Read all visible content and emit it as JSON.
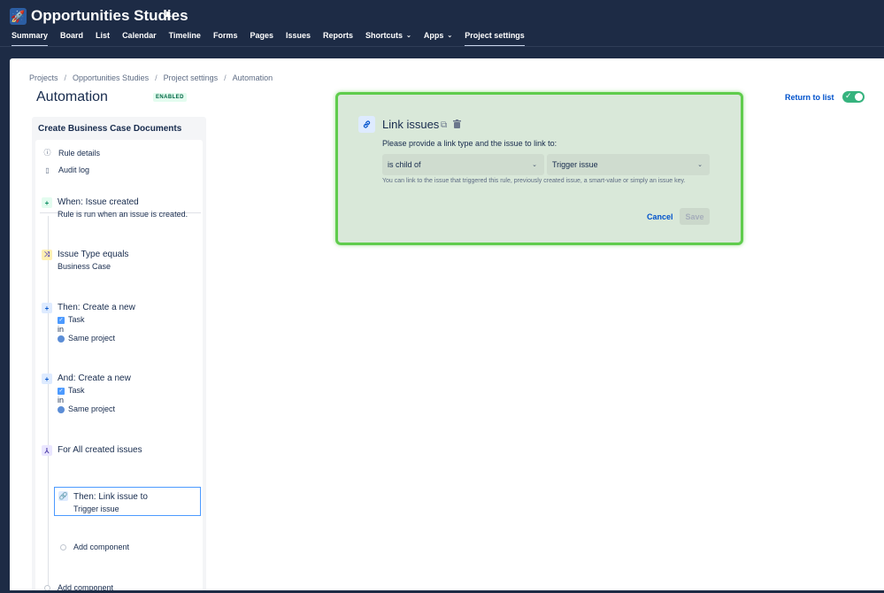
{
  "header": {
    "project_title": "Opportunities Studies",
    "nav": [
      {
        "label": "Summary"
      },
      {
        "label": "Board"
      },
      {
        "label": "List"
      },
      {
        "label": "Calendar"
      },
      {
        "label": "Timeline"
      },
      {
        "label": "Forms"
      },
      {
        "label": "Pages"
      },
      {
        "label": "Issues"
      },
      {
        "label": "Reports"
      },
      {
        "label": "Shortcuts"
      },
      {
        "label": "Apps"
      },
      {
        "label": "Project settings"
      }
    ]
  },
  "breadcrumb": [
    "Projects",
    "Opportunities Studies",
    "Project settings",
    "Automation"
  ],
  "page": {
    "title": "Automation",
    "status": "ENABLED",
    "return_link": "Return to list",
    "toggle_on": true
  },
  "rule": {
    "name": "Create Business Case Documents",
    "links": [
      "Rule details",
      "Audit log"
    ],
    "components": [
      {
        "title": "When: Issue created",
        "sub": [
          "Rule is run when an issue is created."
        ]
      },
      {
        "title": "Issue Type equals",
        "sub": [
          "Business Case"
        ]
      },
      {
        "title": "Then: Create a new",
        "sub": [
          "Task",
          "in",
          "Same project"
        ]
      },
      {
        "title": "And: Create a new",
        "sub": [
          "Task",
          "in",
          "Same project"
        ]
      },
      {
        "title": "For All created issues",
        "sub": []
      },
      {
        "title": "Then: Link issue to",
        "sub": [
          "Trigger issue"
        ]
      }
    ],
    "add_component_inner": "Add component",
    "add_component_outer": "Add component"
  },
  "editor": {
    "title": "Link issues",
    "prompt": "Please provide a link type and the issue to link to:",
    "link_type": "is child of",
    "target_issue": "Trigger issue",
    "help": "You can link to the issue that triggered this rule, previously created issue, a smart-value or simply an issue key.",
    "cancel_label": "Cancel",
    "save_label": "Save"
  },
  "colors": {
    "header_bg": "#1d2b45",
    "accent": "#0052cc",
    "highlight_border": "#5fcc4c",
    "toggle_on": "#36b37e"
  }
}
